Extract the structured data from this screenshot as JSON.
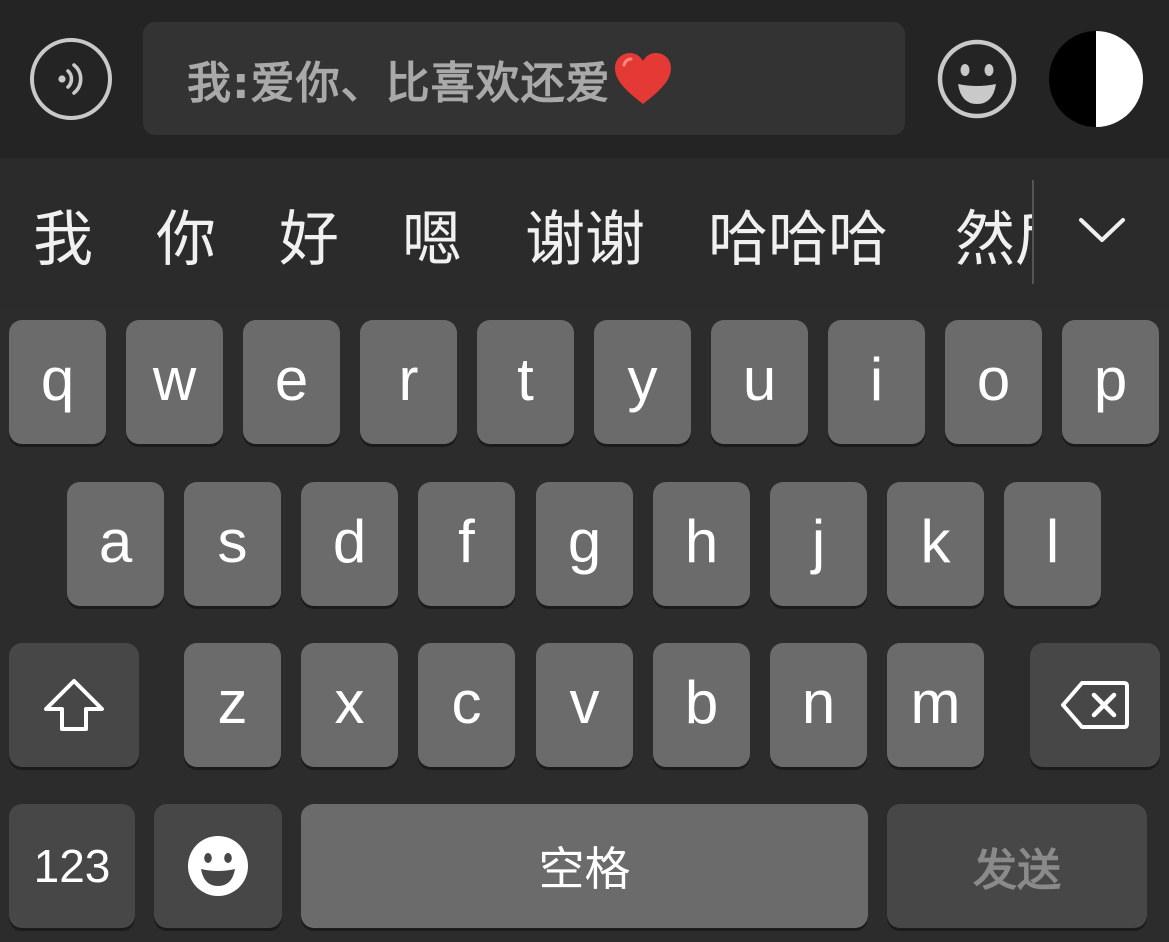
{
  "input_bar": {
    "message_text": "我:爱你、比喜欢还爱",
    "voice_icon": "voice-wave-icon",
    "emoji_icon": "smiley-face-icon",
    "toggle_icon": "half-circle-contrast-icon",
    "heart_icon": "red-heart-icon"
  },
  "candidates": [
    "我",
    "你",
    "好",
    "嗯",
    "谢谢",
    "哈哈哈",
    "然后"
  ],
  "candidate_expand_icon": "chevron-down-icon",
  "keyboard": {
    "row1": [
      "q",
      "w",
      "e",
      "r",
      "t",
      "y",
      "u",
      "i",
      "o",
      "p"
    ],
    "row2": [
      "a",
      "s",
      "d",
      "f",
      "g",
      "h",
      "j",
      "k",
      "l"
    ],
    "row3": [
      "z",
      "x",
      "c",
      "v",
      "b",
      "n",
      "m"
    ],
    "shift_icon": "shift-arrow-icon",
    "backspace_icon": "backspace-icon",
    "numbers_label": "123",
    "emoji_icon": "smiley-face-icon",
    "space_label": "空格",
    "send_label": "发送"
  },
  "colors": {
    "background": "#2c2c2c",
    "key": "#6b6b6b",
    "function_key": "#474747",
    "heart": "#e53935",
    "send_disabled_text": "#8a8a8a"
  }
}
